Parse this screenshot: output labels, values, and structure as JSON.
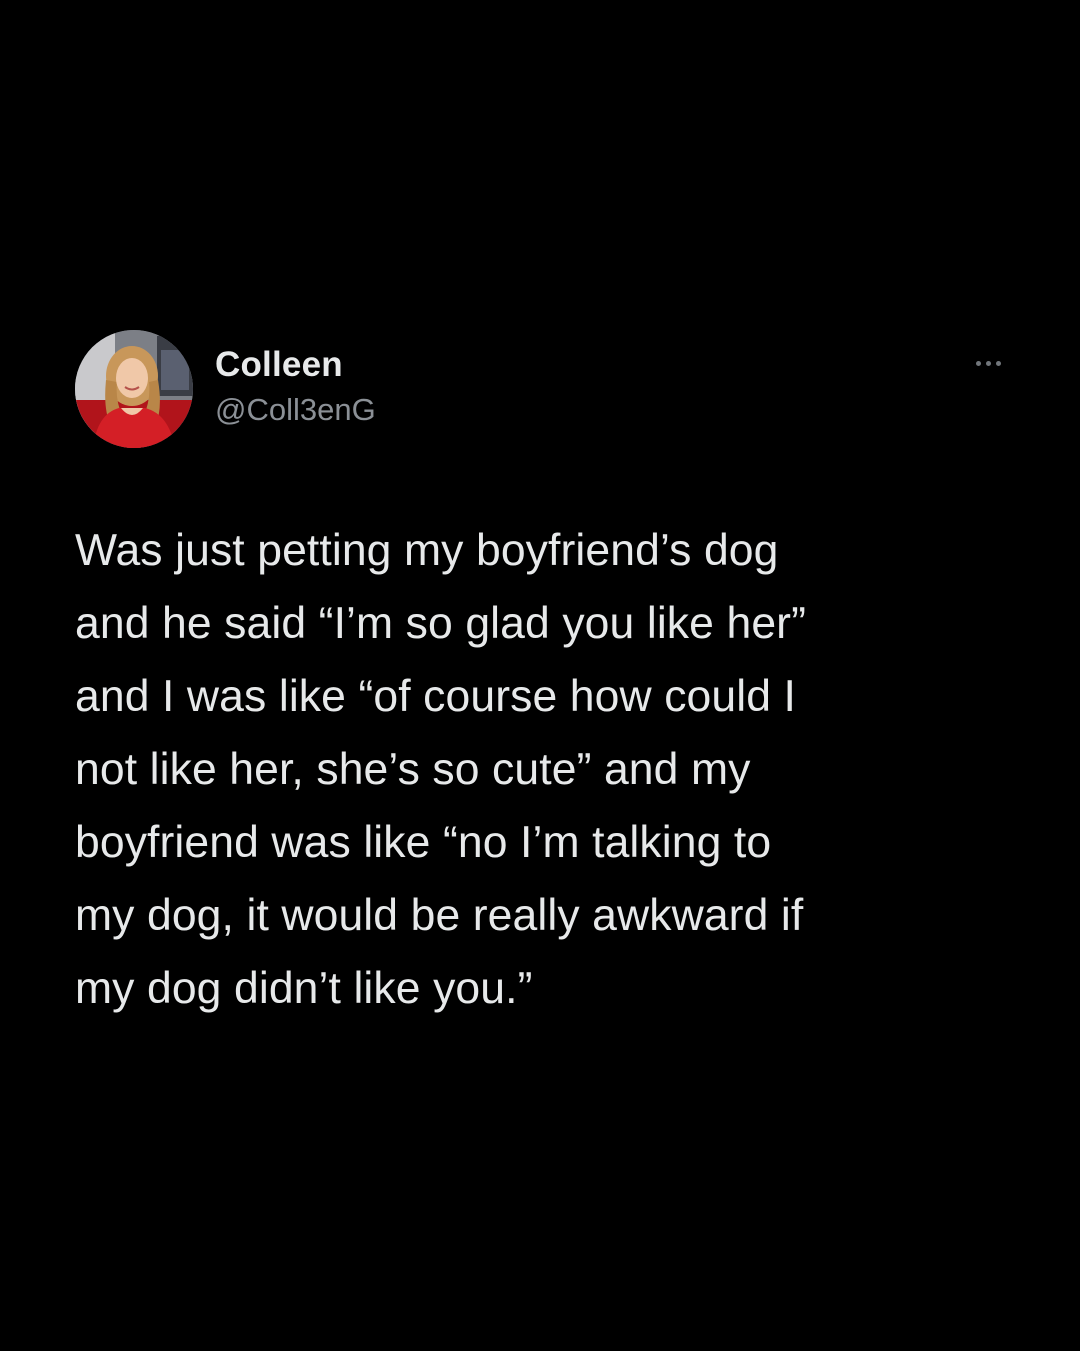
{
  "tweet": {
    "author": {
      "display_name": "Colleen",
      "handle": "@Coll3enG",
      "avatar_icon": "profile-photo"
    },
    "more_icon": "more-options-icon",
    "text": "Was just petting my boyfriend’s dog\nand he said “I’m so glad you like her”\nand I was like “of course how could I\nnot like her, she’s so cute” and my\nboyfriend was like “no I’m talking to\nmy dog, it would be really awkward if\nmy dog didn’t like you.”"
  },
  "colors": {
    "background": "#000000",
    "text": "#e7e9ea",
    "secondary_text": "#8b9096",
    "avatar_dress": "#d41f26"
  }
}
